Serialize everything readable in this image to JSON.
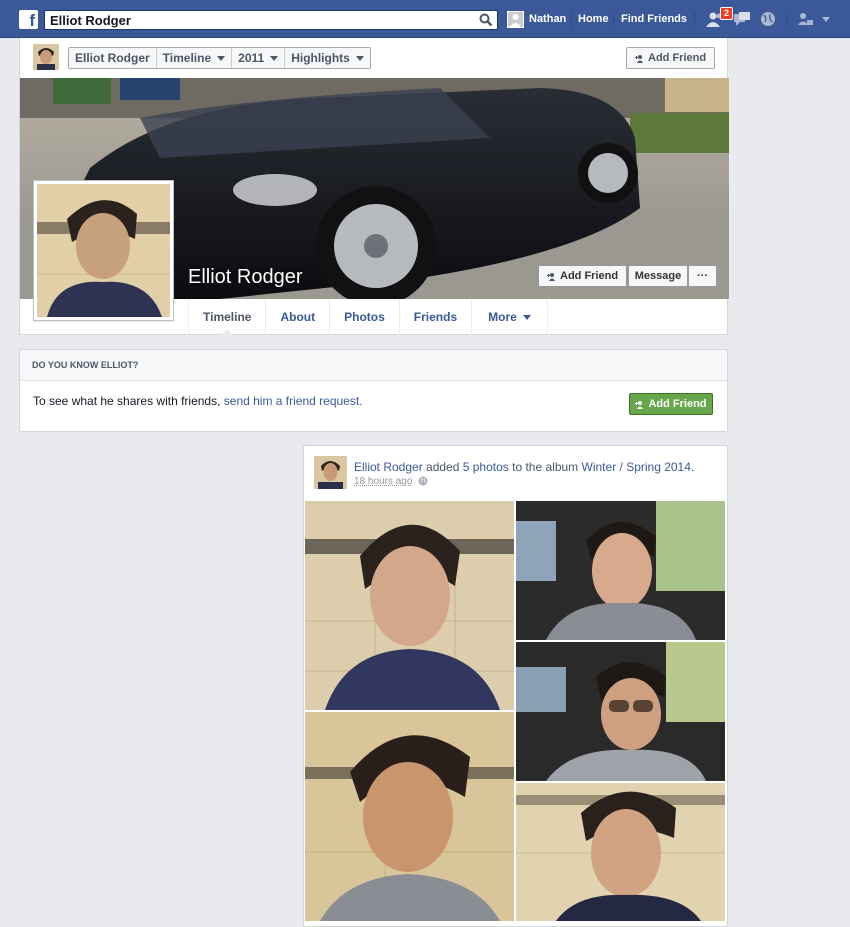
{
  "topbar": {
    "logo": "f",
    "search_value": "Elliot Rodger",
    "user_name": "Nathan",
    "home": "Home",
    "find_friends": "Find Friends",
    "friend_requests_badge": "2"
  },
  "header": {
    "crumbs": [
      "Elliot Rodger",
      "Timeline",
      "2011",
      "Highlights"
    ],
    "add_friend_top": "Add Friend",
    "name": "Elliot Rodger",
    "add_friend": "Add Friend",
    "message": "Message",
    "more_options": "···",
    "tabs": [
      "Timeline",
      "About",
      "Photos",
      "Friends",
      "More"
    ]
  },
  "know": {
    "title": "DO YOU KNOW ELLIOT?",
    "text": "To see what he shares with friends, ",
    "link": "send him a friend request.",
    "button": "Add Friend"
  },
  "post": {
    "author": "Elliot Rodger",
    "verb": " added ",
    "count_link": "5 photos",
    "to_album": " to the album ",
    "album": "Winter / Spring 2014",
    "period": ".",
    "time": "18 hours ago"
  },
  "colors": {
    "brand": "#3b5998",
    "green": "#69a74e",
    "background": "#e9eaed"
  }
}
